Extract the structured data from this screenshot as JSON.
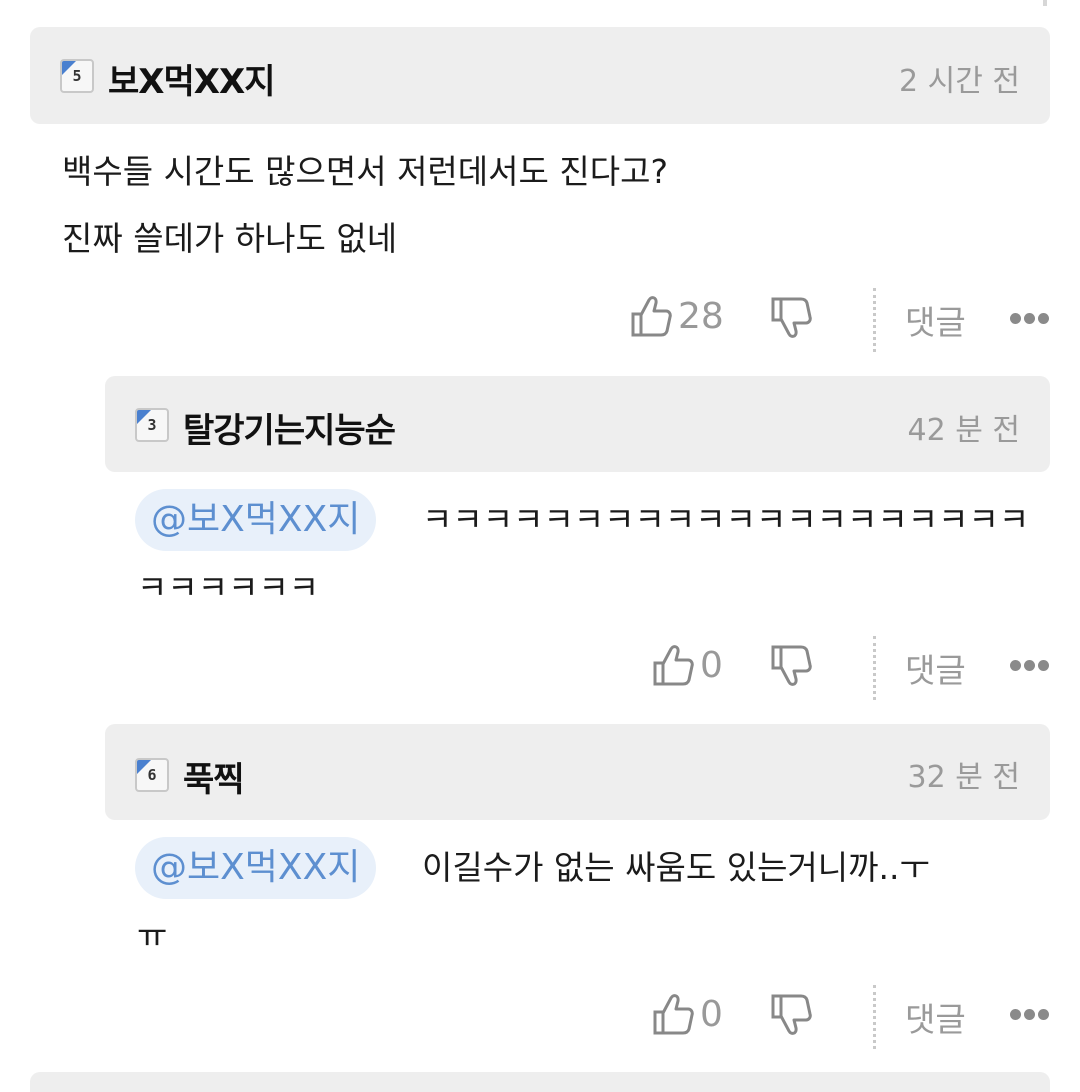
{
  "comments": [
    {
      "badge": "5",
      "nickname": "보X먹XX지",
      "time": "2 시간 전",
      "lines": [
        "백수들 시간도 많으면서 저런데서도 진다고?",
        "진짜 쓸데가 하나도 없네"
      ],
      "likes": "28",
      "reply_label": "댓글"
    },
    {
      "badge": "3",
      "nickname": "탈강기는지능순",
      "time": "42 분 전",
      "mention": "@보X먹XX지",
      "lines": [
        "ㅋㅋㅋㅋㅋㅋㅋㅋㅋㅋㅋㅋㅋㅋㅋㅋㅋㅋㅋㅋ",
        "ㅋㅋㅋㅋㅋㅋ"
      ],
      "likes": "0",
      "reply_label": "댓글"
    },
    {
      "badge": "6",
      "nickname": "푹찍",
      "time": "32 분 전",
      "mention": "@보X먹XX지",
      "lines": [
        "이길수가 없는 싸움도 있는거니까..ㅜ",
        "ㅠ"
      ],
      "likes": "0",
      "reply_label": "댓글"
    }
  ],
  "colors": {
    "header_bg": "#eeeeee",
    "mention_bg": "#e8f0fa",
    "mention_text": "#5d8fd0",
    "badge_accent": "#4a80cf",
    "muted_text": "#9a9a9a"
  }
}
